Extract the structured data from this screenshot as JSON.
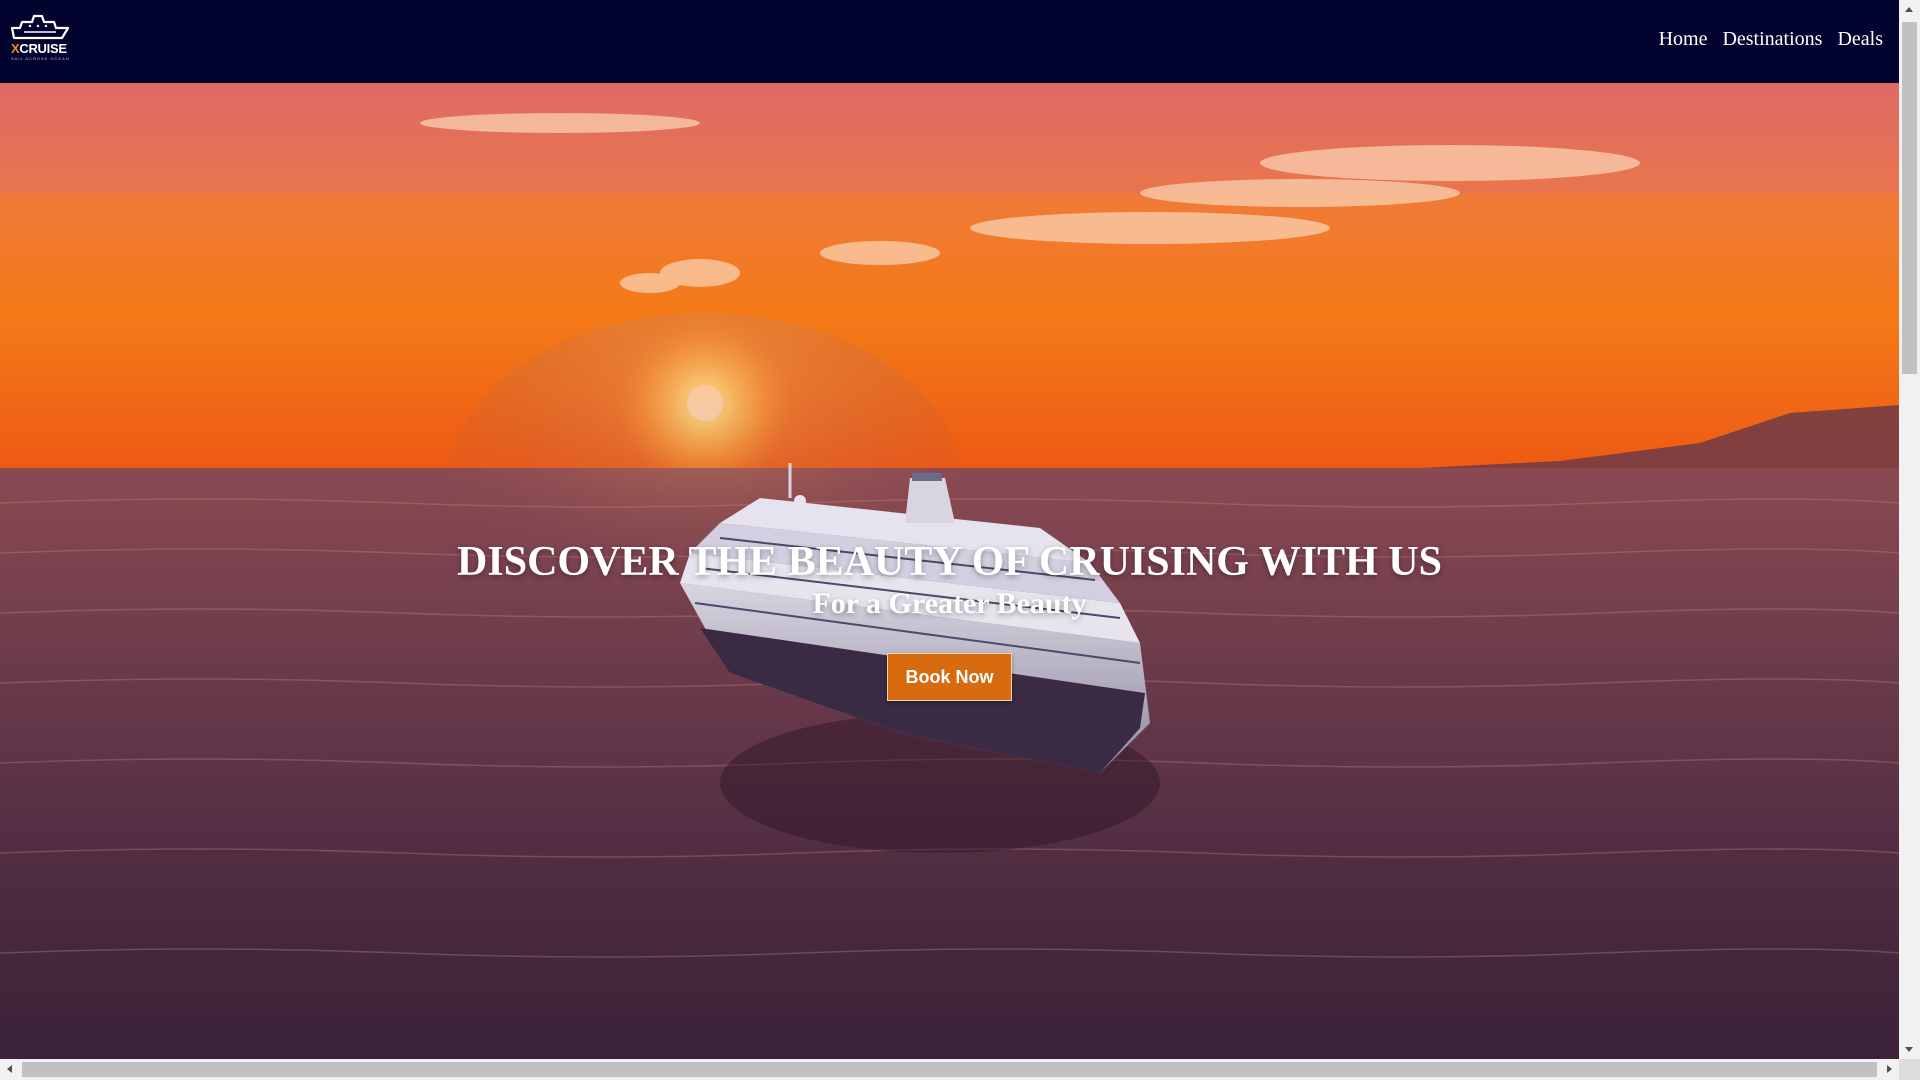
{
  "brand": {
    "name_accent": "X",
    "name_rest": "CRUISE",
    "tagline": "SAIL ACROSS OCEAN",
    "accent_color": "#f08a1c"
  },
  "nav": {
    "background": "#03032f",
    "items": [
      {
        "label": "Home"
      },
      {
        "label": "Destinations"
      },
      {
        "label": "Deals"
      }
    ]
  },
  "hero": {
    "title": "DISCOVER THE BEAUTY OF CRUISING WITH US",
    "subtitle": "For a Greater Beauty",
    "cta_label": "Book Now",
    "cta_color": "#d86a10"
  },
  "icons": {
    "logo": "cruise-ship-logo-icon",
    "sun": "sun",
    "ship": "cruise-ship"
  }
}
